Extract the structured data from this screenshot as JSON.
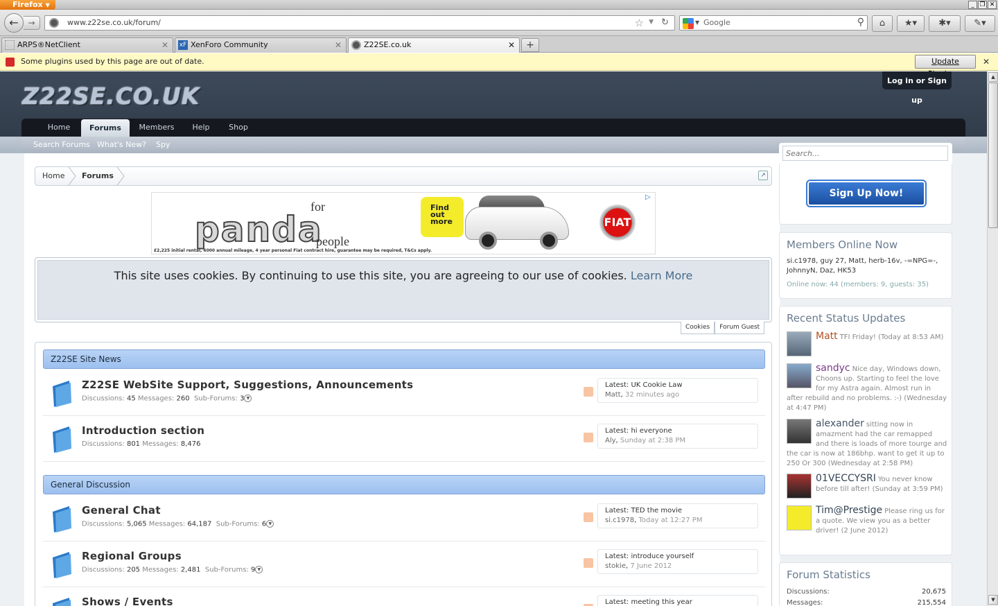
{
  "browser": {
    "app_button": "Firefox",
    "url": "www.z22se.co.uk/forum/",
    "search_placeholder": "Google",
    "tabs": [
      {
        "title": "ARPS®NetClient"
      },
      {
        "title": "XenForo Community"
      },
      {
        "title": "Z22SE.co.uk"
      }
    ],
    "plugin_bar": {
      "message": "Some plugins used by this page are out of date.",
      "button": "Update Plugins..."
    }
  },
  "site": {
    "logo": "Z22SE.CO.UK",
    "login": "Log in or Sign up",
    "nav": [
      "Home",
      "Forums",
      "Members",
      "Help",
      "Shop"
    ],
    "active_nav": "Forums",
    "subnav": [
      "Search Forums",
      "What's New?",
      "Spy"
    ]
  },
  "breadcrumb": [
    "Home",
    "Forums"
  ],
  "ad": {
    "for": "for",
    "brand": "panda",
    "people": "people",
    "find_out": "Find out more",
    "logo": "FIAT",
    "terms": "£2,225 initial rental, 6000 annual mileage, 4 year personal Fiat contract hire, guarantee may be required, T&Cs apply."
  },
  "cookie": {
    "text": "This site uses cookies. By continuing to use this site, you are agreeing to our use of cookies.",
    "link": "Learn More",
    "tabs": [
      "Cookies",
      "Forum Guest"
    ]
  },
  "categories": [
    {
      "title": "Z22SE Site News",
      "nodes": [
        {
          "title": "Z22SE WebSite Support, Suggestions, Announcements",
          "discussions": "45",
          "messages": "260",
          "subforums": "3",
          "latest": "UK Cookie Law",
          "by": "Matt",
          "when": "32 minutes ago"
        },
        {
          "title": "Introduction section",
          "discussions": "801",
          "messages": "8,476",
          "subforums": "",
          "latest": "hi everyone",
          "by": "Aly",
          "when": "Sunday at 2:38 PM"
        }
      ]
    },
    {
      "title": "General Discussion",
      "nodes": [
        {
          "title": "General Chat",
          "discussions": "5,065",
          "messages": "64,187",
          "subforums": "6",
          "latest": "TED the movie",
          "by": "si.c1978",
          "when": "Today at 12:27 PM"
        },
        {
          "title": "Regional Groups",
          "discussions": "205",
          "messages": "2,481",
          "subforums": "9",
          "latest": "introduce yourself",
          "by": "stokie",
          "when": "7 June 2012"
        },
        {
          "title": "Shows / Events",
          "discussions": "",
          "messages": "",
          "subforums": "",
          "latest": "meeting this year",
          "by": "",
          "when": ""
        }
      ]
    }
  ],
  "labels": {
    "discussions": "Discussions:",
    "messages": "Messages:",
    "subforums": "Sub-Forums:",
    "latest": "Latest:"
  },
  "sidebar": {
    "search_placeholder": "Search...",
    "signup": "Sign Up Now!",
    "online": {
      "title": "Members Online Now",
      "members": "si.c1978, guy 27, Matt, herb-16v, -=NPG=-, JohnnyN, Daz, HK53",
      "summary": "Online now: 44 (members: 9, guests: 35)"
    },
    "status": {
      "title": "Recent Status Updates",
      "items": [
        {
          "name": "Matt",
          "text": "TFI Friday! (Today at 8:53 AM)"
        },
        {
          "name": "sandyc",
          "text": "Nice day, Windows down, Choons up. Starting to feel the love for my Astra again. Almost run in after rebuild and no problems. :-) (Wednesday at 4:47 PM)"
        },
        {
          "name": "alexander",
          "text": "sitting now in amazment had the car remapped and there is loads of more tourge and the car is now at 186bhp. want to get it up to 250 Or 300 (Wednesday at 2:58 PM)"
        },
        {
          "name": "01VECCYSRI",
          "text": "You never know before till after! (Sunday at 3:59 PM)"
        },
        {
          "name": "Tim@Prestige",
          "text": "Please ring us for a quote. We view you as a better driver! (2 June 2012)"
        }
      ]
    },
    "stats": {
      "title": "Forum Statistics",
      "rows": [
        {
          "label": "Discussions:",
          "value": "20,675"
        },
        {
          "label": "Messages:",
          "value": "215,554"
        }
      ]
    }
  },
  "colors": {
    "header": "#3d4a5a",
    "category": "#9cc0ef",
    "signup": "#1b4fa0"
  }
}
